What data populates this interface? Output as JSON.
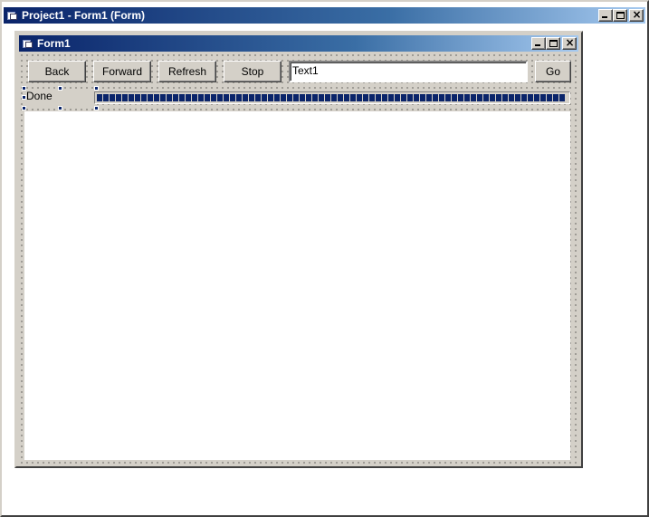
{
  "outer_window": {
    "title": "Project1 - Form1 (Form)"
  },
  "form": {
    "title": "Form1",
    "toolbar": {
      "back_label": "Back",
      "forward_label": "Forward",
      "refresh_label": "Refresh",
      "stop_label": "Stop",
      "go_label": "Go"
    },
    "address_value": "Text1",
    "status_text": "Done",
    "progress_value": 1.0
  },
  "colors": {
    "titlebar_start": "#0a246a",
    "titlebar_end": "#a6caf0",
    "face": "#d4d0c8"
  }
}
